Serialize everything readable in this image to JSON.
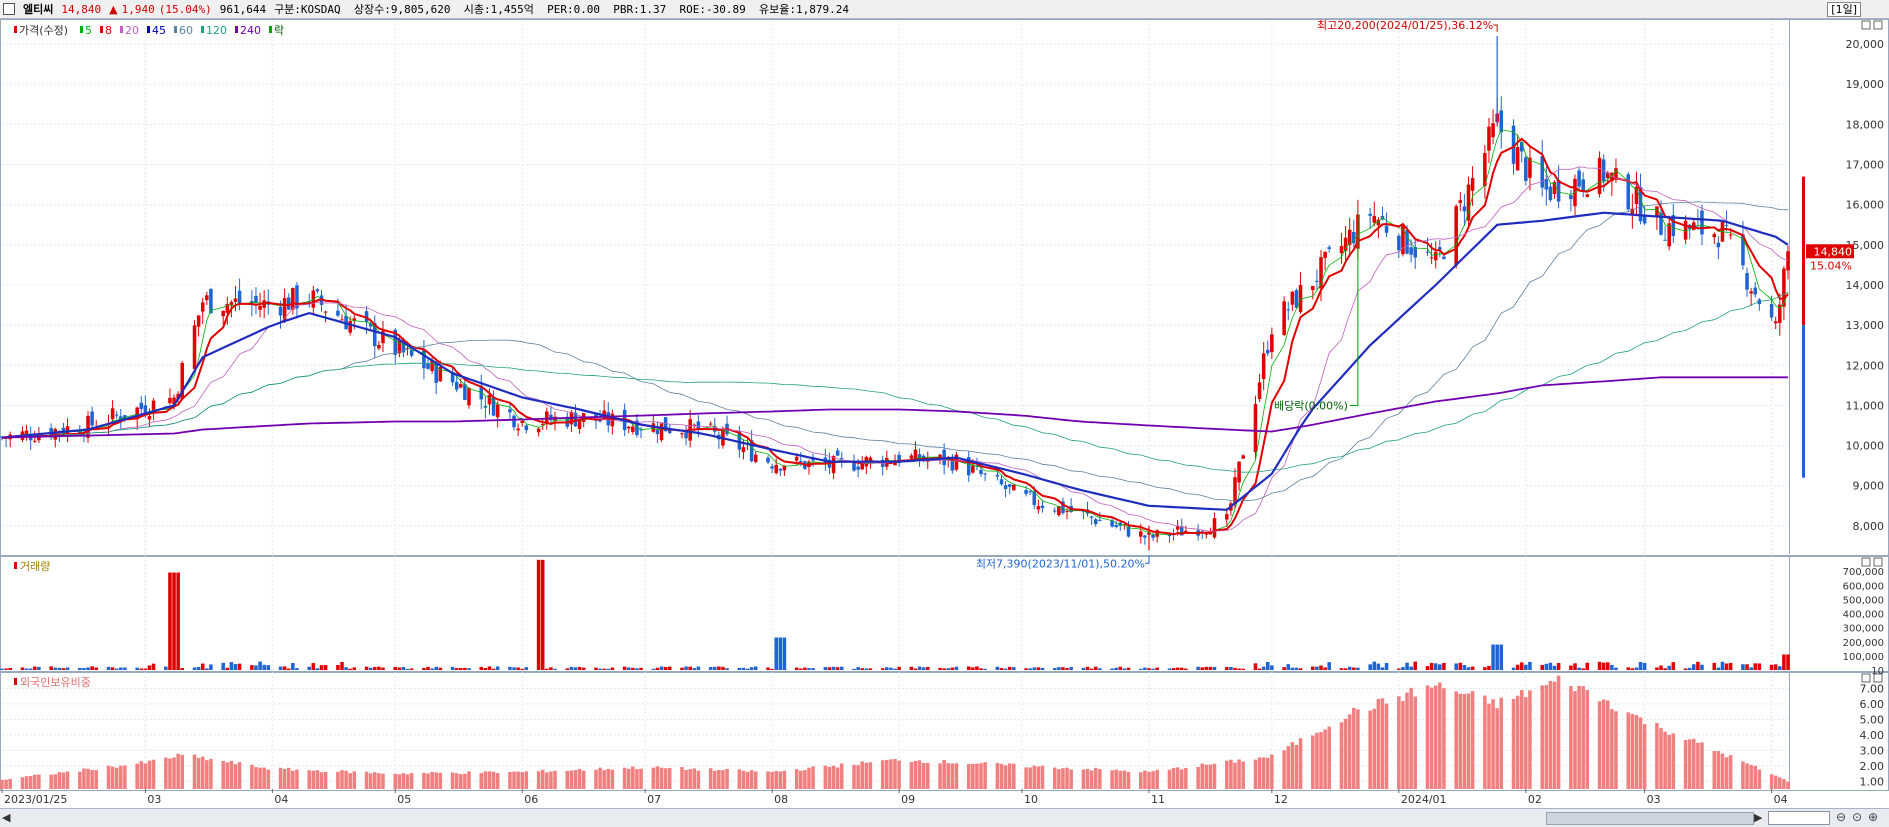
{
  "header": {
    "stock_name": "엘티씨",
    "price": "14,840",
    "change_arrow": "▲",
    "change": "1,940",
    "change_pct": "(15.04%)",
    "volume": "961,644",
    "info": "구분:KOSDAQ  상장수:9,805,620  시총:1,455억  PER:0.00  PBR:1.37  ROE:-30.89  유보율:1,879.24",
    "period": "[1일]"
  },
  "legend": {
    "price_label": "가격(수정)",
    "ma": [
      {
        "label": "5",
        "color": "#00b000"
      },
      {
        "label": "8",
        "color": "#e00000"
      },
      {
        "label": "20",
        "color": "#c060c0"
      },
      {
        "label": "45",
        "color": "#0000c0"
      },
      {
        "label": "60",
        "color": "#6080a0"
      },
      {
        "label": "120",
        "color": "#20a080"
      },
      {
        "label": "240",
        "color": "#7000b0"
      }
    ],
    "drop_label": "락",
    "volume_label": "거래량",
    "foreign_label": "외국인보유비중"
  },
  "annotations": {
    "high": "최고20,200(2024/01/25),36.12%",
    "low": "최저7,390(2023/11/01),50.20%",
    "dividend": "배당락(0.00%)",
    "current_price_tag": "14,840",
    "current_pct_tag": "15.04%"
  },
  "x_labels": [
    "2023/01/25",
    "03",
    "04",
    "05",
    "06",
    "07",
    "08",
    "09",
    "10",
    "11",
    "12",
    "2024/01",
    "02",
    "03",
    "04"
  ],
  "chart_data": [
    {
      "type": "line",
      "title": "가격(수정)",
      "ylim": [
        7300,
        20600
      ],
      "y_ticks": [
        "8,000",
        "9,000",
        "10,000",
        "11,000",
        "12,000",
        "13,000",
        "14,000",
        "15,000",
        "16,000",
        "17,000",
        "18,000",
        "19,000",
        "20,000"
      ],
      "x": [
        "2023/01/25",
        "2023/02/15",
        "2023/03/08",
        "2023/03/15",
        "2023/04/01",
        "2023/04/10",
        "2023/05/01",
        "2023/05/15",
        "2023/06/01",
        "2023/06/15",
        "2023/07/01",
        "2023/07/15",
        "2023/08/01",
        "2023/08/15",
        "2023/09/01",
        "2023/09/15",
        "2023/10/01",
        "2023/10/15",
        "2023/11/01",
        "2023/11/20",
        "2023/12/01",
        "2023/12/10",
        "2023/12/25",
        "2024/01/10",
        "2024/01/25",
        "2024/02/05",
        "2024/02/20",
        "2024/03/05",
        "2024/03/20",
        "2024/04/02",
        "2024/04/05"
      ],
      "series": [
        {
          "name": "close",
          "values": [
            10200,
            10500,
            11200,
            13600,
            13500,
            13700,
            12400,
            11600,
            10600,
            10700,
            10500,
            10400,
            9600,
            9500,
            9700,
            9600,
            8700,
            8300,
            7700,
            8100,
            13000,
            14000,
            15800,
            14500,
            18000,
            16300,
            16800,
            15500,
            15300,
            12900,
            14840
          ]
        },
        {
          "name": "45",
          "values": [
            10200,
            10400,
            11000,
            12200,
            13000,
            13300,
            12700,
            11800,
            11200,
            10900,
            10500,
            10300,
            9900,
            9600,
            9600,
            9700,
            9300,
            8900,
            8500,
            8400,
            9300,
            10800,
            12500,
            14000,
            15500,
            15600,
            15800,
            15700,
            15600,
            15200,
            15000
          ]
        },
        {
          "name": "240",
          "values": [
            10200,
            10250,
            10300,
            10400,
            10500,
            10550,
            10600,
            10600,
            10650,
            10700,
            10750,
            10800,
            10850,
            10900,
            10900,
            10850,
            10750,
            10600,
            10500,
            10400,
            10350,
            10500,
            10800,
            11100,
            11300,
            11500,
            11600,
            11700,
            11700,
            11700,
            11700
          ]
        }
      ],
      "markers": {
        "high": 20200,
        "low": 7390,
        "last": 14840
      }
    },
    {
      "type": "bar",
      "title": "거래량",
      "ylim": [
        0,
        800000
      ],
      "y_ticks": [
        "10",
        "100,000",
        "200,000",
        "300,000",
        "400,000",
        "500,000",
        "600,000",
        "700,000"
      ],
      "peaks": [
        {
          "date": "2023/03/08",
          "value": 690000,
          "up": true
        },
        {
          "date": "2023/06/05",
          "value": 780000,
          "up": true
        },
        {
          "date": "2023/08/03",
          "value": 230000,
          "up": false
        },
        {
          "date": "2024/01/25",
          "value": 180000,
          "up": false
        },
        {
          "date": "2024/04/05",
          "value": 110000,
          "up": true
        }
      ]
    },
    {
      "type": "bar",
      "title": "외국인보유비중",
      "ylim": [
        0.5,
        8.0
      ],
      "y_ticks": [
        "1.00",
        "2.00",
        "3.00",
        "4.00",
        "5.00",
        "6.00",
        "7.00"
      ],
      "x": [
        "2023/01/25",
        "2023/03/01",
        "2023/03/10",
        "2023/04/01",
        "2023/05/01",
        "2023/06/01",
        "2023/07/01",
        "2023/08/01",
        "2023/09/01",
        "2023/10/01",
        "2023/11/01",
        "2023/12/01",
        "2023/12/20",
        "2024/01/10",
        "2024/01/25",
        "2024/02/10",
        "2024/03/01",
        "2024/03/20",
        "2024/04/05"
      ],
      "values": [
        1.1,
        2.2,
        2.7,
        1.8,
        1.5,
        1.6,
        1.9,
        1.6,
        2.4,
        2.0,
        1.6,
        2.6,
        5.4,
        7.2,
        6.0,
        7.6,
        4.9,
        2.8,
        1.0
      ]
    }
  ]
}
